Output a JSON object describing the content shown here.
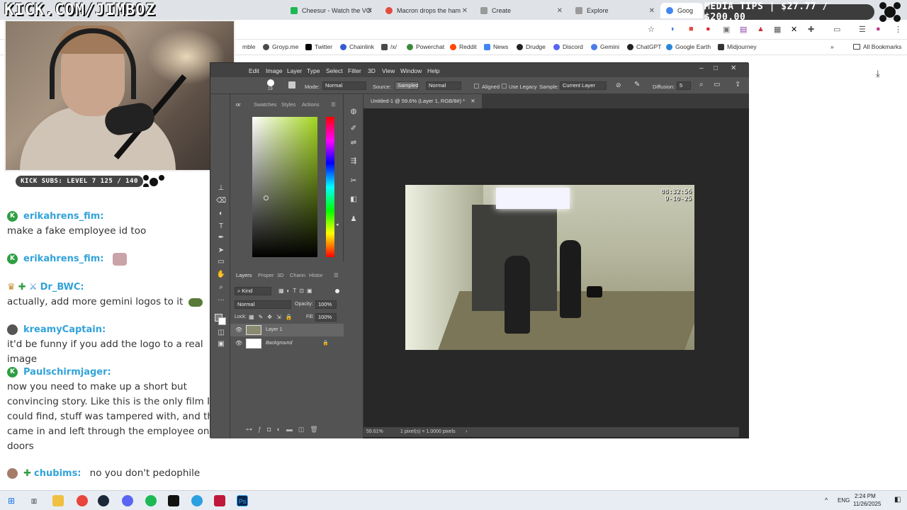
{
  "overlay": {
    "handle": "KICK.COM/JIMBOZ",
    "media_tips": "MEDIA TIPS | $27.77 / $200.00",
    "kick_subs": "KICK SUBS: LEVEL 7 125 / 140"
  },
  "browser": {
    "tabs": [
      {
        "label": "Cheesur - Watch the VO",
        "color": "#1db954"
      },
      {
        "label": "Macron drops the ham",
        "color": "#e24c3c"
      },
      {
        "label": "Create",
        "color": "#888888"
      },
      {
        "label": "Explore",
        "color": "#888888"
      },
      {
        "label": "Goog",
        "color": "#4285f4"
      }
    ],
    "bookmarks": [
      {
        "label": "mble",
        "color": "#7b7b7b"
      },
      {
        "label": "Groyp.me",
        "color": "#4a4a4a"
      },
      {
        "label": "Twitter",
        "color": "#000000"
      },
      {
        "label": "Chainlink",
        "color": "#375bd2"
      },
      {
        "label": "/x/",
        "color": "#4a4a4a"
      },
      {
        "label": "Powerchat",
        "color": "#3a8a3a"
      },
      {
        "label": "Reddit",
        "color": "#ff4500"
      },
      {
        "label": "News",
        "color": "#4285f4"
      },
      {
        "label": "Drudge",
        "color": "#222222"
      },
      {
        "label": "Discord",
        "color": "#5865f2"
      },
      {
        "label": "Gemini",
        "color": "#4a7be8"
      },
      {
        "label": "ChatGPT",
        "color": "#222222"
      },
      {
        "label": "Google Earth",
        "color": "#2a86d8"
      },
      {
        "label": "Midjourney",
        "color": "#333333"
      }
    ],
    "all_bookmarks": "All Bookmarks"
  },
  "chat": {
    "messages": [
      {
        "user": "erikahrens_fim:",
        "text": "make a fake employee id too"
      },
      {
        "user": "erikahrens_fim:",
        "text": ""
      },
      {
        "user": "Dr_BWC:",
        "text": "actually, add more gemini logos to it"
      },
      {
        "user": "kreamyCaptain:",
        "text": "it'd be funny if you add the logo to a real image"
      },
      {
        "user": "Paulschirmjager:",
        "text": "now you need to make up a short but convincing story. Like this is the only film I could find, stuff was tampered with, and they came in and left through the employee only doors"
      },
      {
        "user": "chubims:",
        "text": "no you don't pedophile"
      }
    ]
  },
  "photoshop": {
    "menu": [
      "Edit",
      "Image",
      "Layer",
      "Type",
      "Select",
      "Filter",
      "3D",
      "View",
      "Window",
      "Help"
    ],
    "options": {
      "brush_size": "19",
      "mode_label": "Mode:",
      "mode_value": "Normal",
      "source_label": "Source:",
      "source_sampled": "Sampled",
      "source_mode": "Normal",
      "aligned": "Aligned",
      "use_legacy": "Use Legacy",
      "sample_label": "Sample:",
      "sample_value": "Current Layer",
      "diffusion_label": "Diffusion:",
      "diffusion_value": "5"
    },
    "color_tabs": [
      "or",
      "Swatches",
      "Styles",
      "Actions"
    ],
    "layer_tabs": [
      "Layers",
      "Proper",
      "3D",
      "Chann",
      "Histor"
    ],
    "layers": {
      "kind": "Kind",
      "blend": "Normal",
      "opacity_label": "Opacity:",
      "opacity": "100%",
      "lock_label": "Lock:",
      "fill_label": "Fill:",
      "fill": "100%",
      "items": [
        "Layer 1",
        "Background"
      ]
    },
    "doc_tab": "Untitled-1 @ 59.6% (Layer 1, RGB/8#) *",
    "status_zoom": "59.61%",
    "status_info": "1 pixel(s) = 1.0000 pixels",
    "cctv_time": "08:32:56",
    "cctv_date": "9-10-25"
  },
  "taskbar": {
    "lang": "ENG",
    "time": "2:24 PM",
    "date": "11/26/2025"
  }
}
